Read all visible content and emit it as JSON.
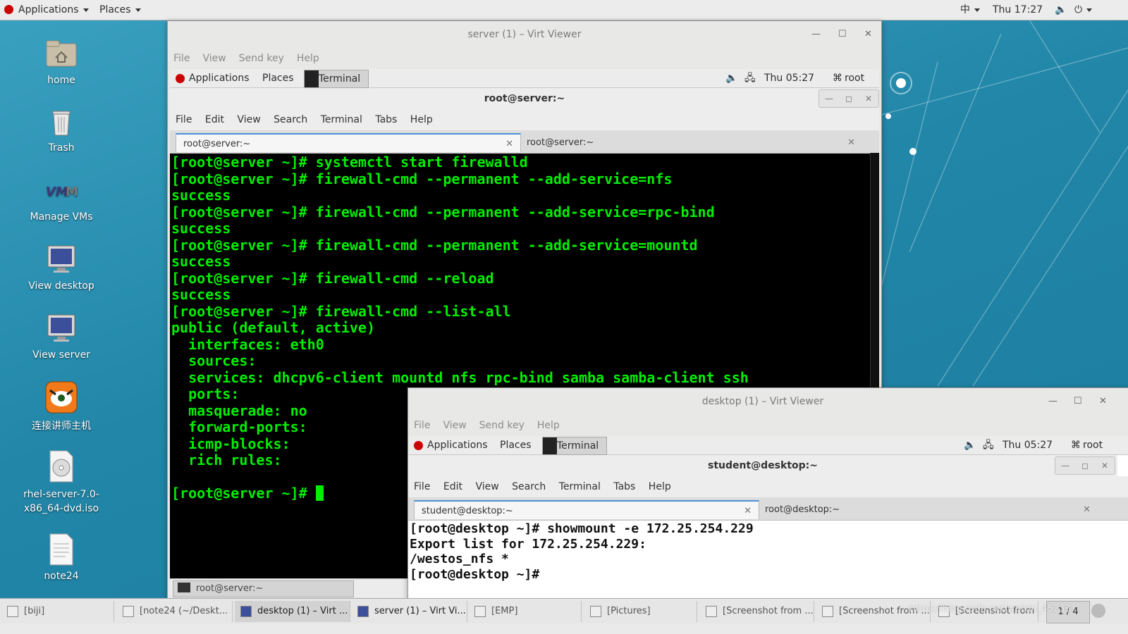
{
  "top_panel": {
    "applications": "Applications",
    "places": "Places",
    "input_method": "中",
    "clock": "Thu 17:27"
  },
  "desktop_icons": [
    {
      "label": "home",
      "icon": "home-folder-icon"
    },
    {
      "label": "Trash",
      "icon": "trash-icon"
    },
    {
      "label": "Manage VMs",
      "icon": "vm-manager-icon"
    },
    {
      "label": "View desktop",
      "icon": "monitor-icon"
    },
    {
      "label": "View server",
      "icon": "monitor-icon"
    },
    {
      "label": "连接讲师主机",
      "icon": "tiger-app-icon"
    },
    {
      "label": "rhel-server-7.0-x86_64-dvd.iso",
      "icon": "disc-image-icon"
    },
    {
      "label": "note24",
      "icon": "text-file-icon"
    }
  ],
  "server_window": {
    "title": "server (1) – Virt Viewer",
    "menu": [
      "File",
      "View",
      "Send key",
      "Help"
    ],
    "guest_panel": {
      "applications": "Applications",
      "places": "Places",
      "terminal": "Terminal",
      "clock": "Thu 05:27",
      "user": "root"
    },
    "terminal": {
      "title": "root@server:~",
      "menu": [
        "File",
        "Edit",
        "View",
        "Search",
        "Terminal",
        "Tabs",
        "Help"
      ],
      "tabs": [
        "root@server:~",
        "root@server:~"
      ],
      "lines": [
        "[root@server ~]# systemctl start firewalld",
        "[root@server ~]# firewall-cmd --permanent --add-service=nfs",
        "success",
        "[root@server ~]# firewall-cmd --permanent --add-service=rpc-bind",
        "success",
        "[root@server ~]# firewall-cmd --permanent --add-service=mountd",
        "success",
        "[root@server ~]# firewall-cmd --reload",
        "success",
        "[root@server ~]# firewall-cmd --list-all",
        "public (default, active)",
        "  interfaces: eth0",
        "  sources: ",
        "  services: dhcpv6-client mountd nfs rpc-bind samba samba-client ssh",
        "  ports: ",
        "  masquerade: no",
        "  forward-ports: ",
        "  icmp-blocks: ",
        "  rich rules: ",
        "",
        "[root@server ~]# "
      ]
    },
    "guest_taskbar_item": "root@server:~"
  },
  "desktop_window": {
    "title": "desktop (1) – Virt Viewer",
    "menu": [
      "File",
      "View",
      "Send key",
      "Help"
    ],
    "guest_panel": {
      "applications": "Applications",
      "places": "Places",
      "terminal": "Terminal",
      "clock": "Thu 05:27",
      "user": "root"
    },
    "terminal": {
      "title": "student@desktop:~",
      "menu": [
        "File",
        "Edit",
        "View",
        "Search",
        "Terminal",
        "Tabs",
        "Help"
      ],
      "tabs": [
        "student@desktop:~",
        "root@desktop:~"
      ],
      "lines": [
        "[root@desktop ~]# showmount -e 172.25.254.229",
        "Export list for 172.25.254.229:",
        "/westos_nfs *",
        "[root@desktop ~]# "
      ]
    }
  },
  "taskbar": {
    "items": [
      "[biji]",
      "[note24 (~/Deskt...",
      "desktop (1) – Virt ...",
      "server (1) – Virt Vi...",
      "[EMP]",
      "[Pictures]",
      "[Screenshot from ...",
      "[Screenshot from ...",
      "[Screenshot from ..."
    ],
    "workspace": "1 / 4",
    "watermark": "https://blog.csdn.net/weixin_45233..."
  }
}
